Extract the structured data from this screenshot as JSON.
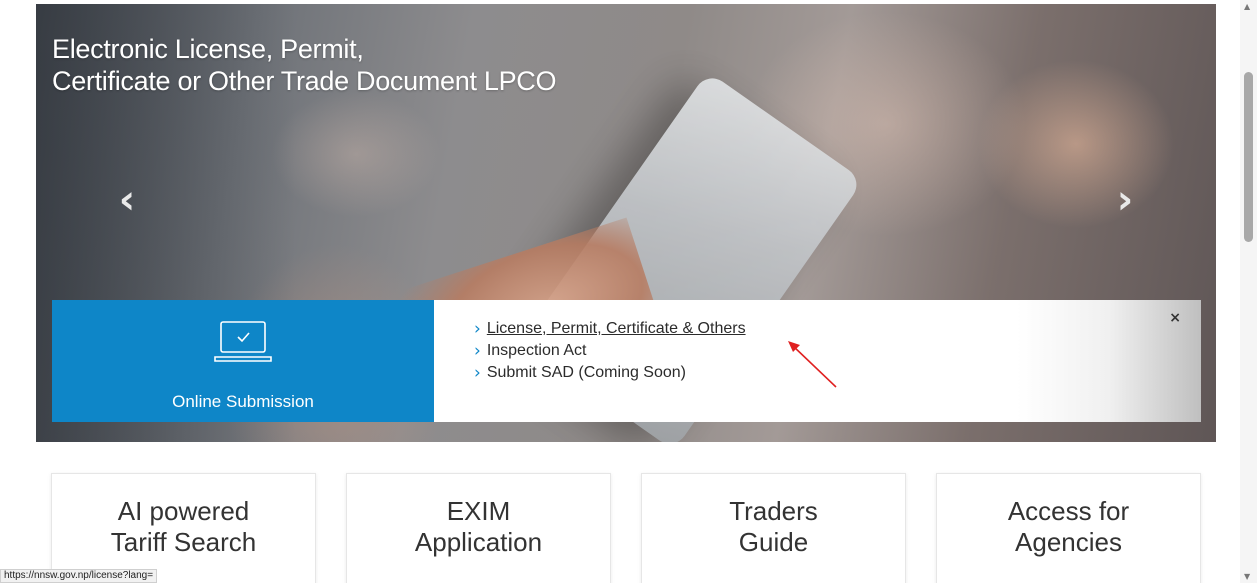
{
  "hero": {
    "title_line1": "Electronic License, Permit,",
    "title_line2": "Certificate or Other Trade Document LPCO",
    "prev_icon": "chevron-left-icon",
    "next_icon": "chevron-right-icon"
  },
  "submission": {
    "label": "Online Submission",
    "icon": "laptop-check-icon",
    "links": [
      "License, Permit, Certificate & Others",
      "Inspection Act",
      "Submit SAD (Coming Soon)"
    ],
    "close": "×"
  },
  "cards": [
    {
      "line1": "AI powered",
      "line2": "Tariff Search"
    },
    {
      "line1": "EXIM",
      "line2": "Application"
    },
    {
      "line1": "Traders",
      "line2": "Guide"
    },
    {
      "line1": "Access for",
      "line2": "Agencies"
    }
  ],
  "status_url": "https://nnsw.gov.np/license?lang=",
  "colors": {
    "accent": "#0e86c8",
    "annotation": "#e02020"
  }
}
